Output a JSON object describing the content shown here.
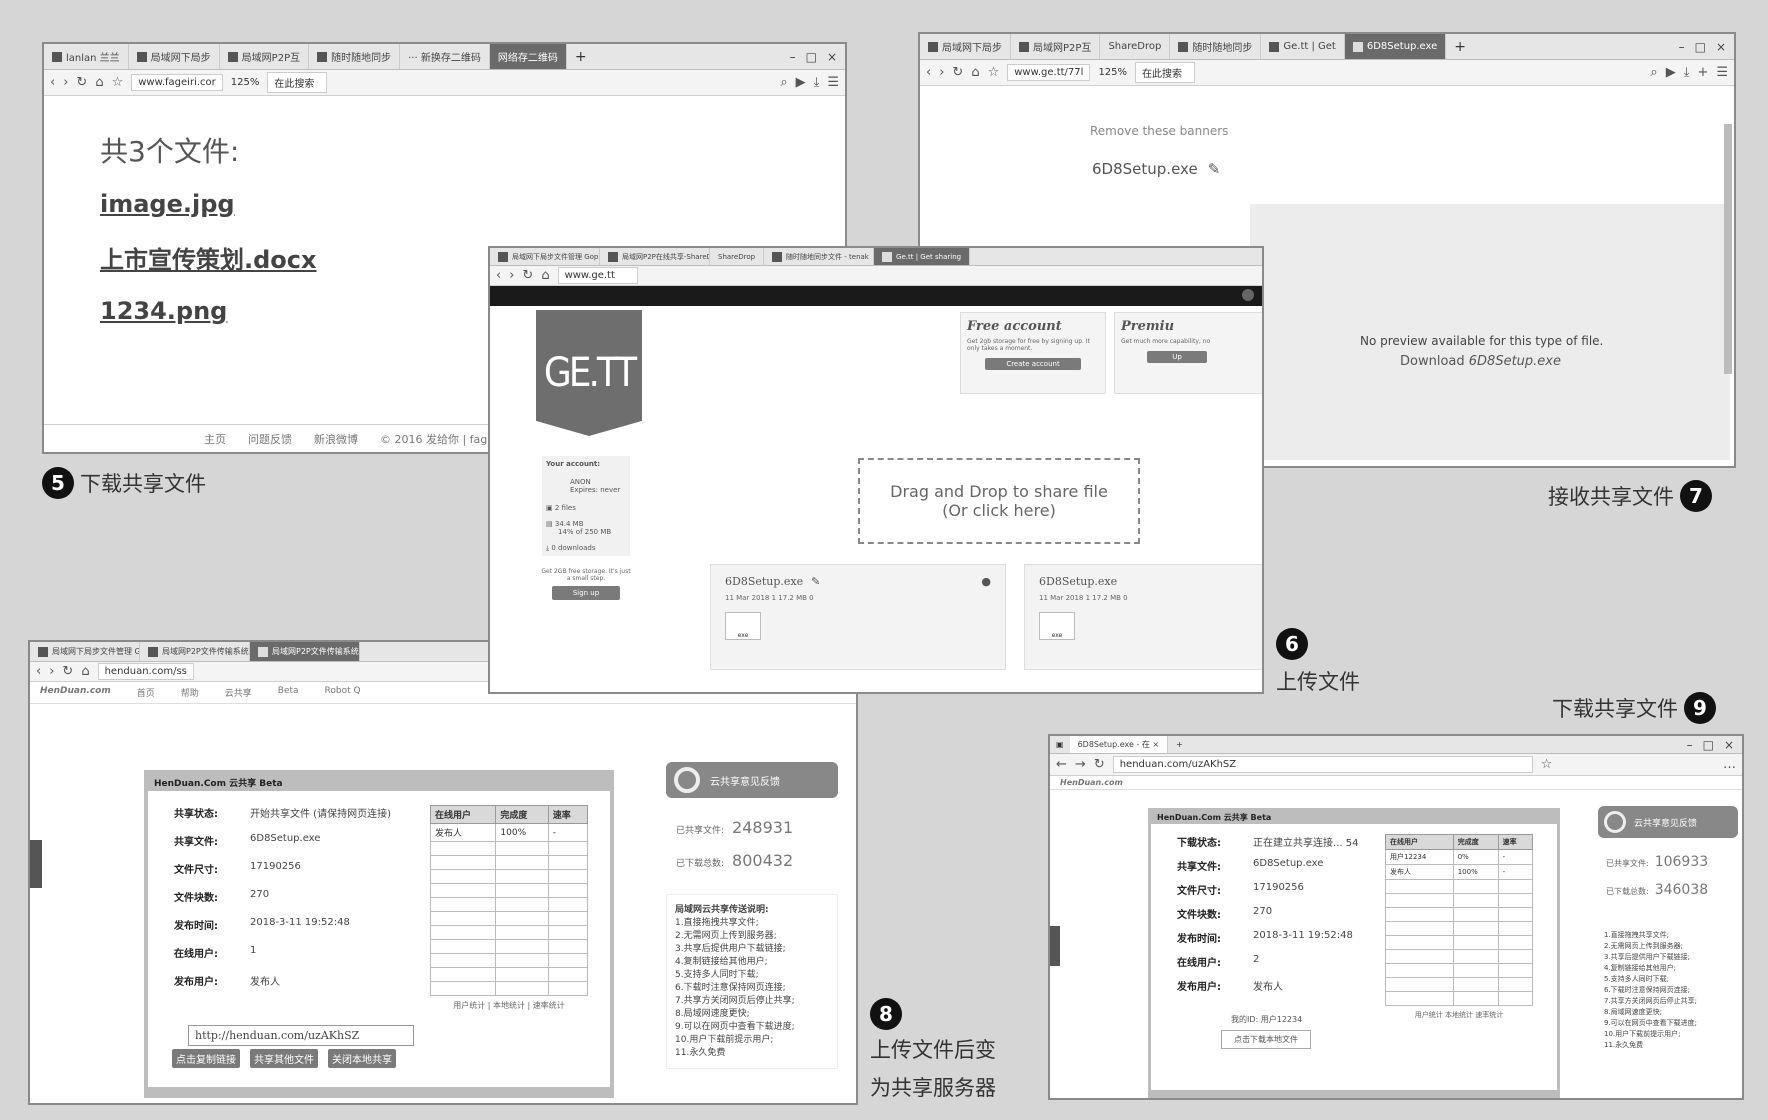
{
  "p5": {
    "tabs": [
      "lanlan 兰兰",
      "局域网下局步",
      "局域网P2P互",
      "随时随地同步",
      "··· 新换存二维码",
      "网络存二维码"
    ],
    "url": "www.fageiri.cor",
    "zoom": "125%",
    "search": "在此搜索",
    "heading": "共3个文件:",
    "files": [
      "image.jpg",
      "上市宣传策划.docx",
      "1234.png"
    ],
    "footer": [
      "主页",
      "问题反馈",
      "新浪微博",
      "© 2016 发给你 | fag"
    ],
    "label": "下载共享文件",
    "num": "5"
  },
  "p7": {
    "tabs": [
      "局域网下局步",
      "局域网P2P互",
      "ShareDrop",
      "随时随地同步",
      "Ge.tt | Get",
      "6D8Setup.exe"
    ],
    "url": "www.ge.tt/77l",
    "zoom": "125%",
    "search": "在此搜索",
    "banner": "Remove these banners",
    "filename": "6D8Setup.exe",
    "no_preview": "No preview available for this type of file.",
    "download_prefix": "Download",
    "download_file": "6D8Setup.exe",
    "label": "接收共享文件",
    "num": "7"
  },
  "p6": {
    "tabs": [
      "局域网下局步文件管理 Gopro.tv",
      "局域网P2P在线共享-ShareDrop",
      "ShareDrop",
      "随时随地同步文件 - tenak",
      "Ge.tt | Get sharing"
    ],
    "url": "www.ge.tt",
    "logo": "GE.TT",
    "free_title": "Free account",
    "free_desc": "Get 2gb storage for free by signing up. It only takes a moment.",
    "free_btn": "Create account",
    "premium_title": "Premiu",
    "premium_desc": "Get much more capability, no",
    "premium_btn": "Up",
    "account_title": "Your account:",
    "account_line1": "ANON",
    "account_line2": "Expires: never",
    "stats": [
      "2 files",
      "34.4 MB",
      "14% of 250 MB",
      "0 downloads"
    ],
    "promo": "Get 2GB free storage. It's just a small step.",
    "signup": "Sign up",
    "drop_line1": "Drag and Drop to share file",
    "drop_line2": "(Or click here)",
    "file_name": "6D8Setup.exe",
    "file_meta": "11 Mar 2018   1   17.2 MB   0",
    "file_ext": "exe",
    "label": "上传文件",
    "num": "6"
  },
  "p8": {
    "tabs": [
      "局域网下局步文件管理 Gopro.tv",
      "局域网P2P文件传输系统-众共享 | 免费",
      "局域网P2P文件传输系统-众共享 | 免费"
    ],
    "url": "henduan.com/ss",
    "site": "HenDuan.com",
    "nav": [
      "首页",
      "帮助",
      "云共享",
      "Beta",
      "Robot Q"
    ],
    "panel_title": "HenDuan.Com 云共享 Beta",
    "fields": [
      {
        "k": "共享状态:",
        "v": "开始共享文件 (请保持网页连接)"
      },
      {
        "k": "共享文件:",
        "v": "6D8Setup.exe"
      },
      {
        "k": "文件尺寸:",
        "v": "17190256"
      },
      {
        "k": "文件块数:",
        "v": "270"
      },
      {
        "k": "发布时间:",
        "v": "2018-3-11 19:52:48"
      },
      {
        "k": "在线用户:",
        "v": "1"
      },
      {
        "k": "发布用户:",
        "v": "发布人"
      }
    ],
    "share_url": "http://henduan.com/uzAKhSZ",
    "buttons": [
      "点击复制链接",
      "共享其他文件",
      "关闭本地共享"
    ],
    "table_head": [
      "在线用户",
      "完成度",
      "速率"
    ],
    "table_row": [
      "发布人",
      "100%",
      "-"
    ],
    "table_footer": "用户统计 | 本地统计 | 速率统计",
    "feedback": "云共享意见反馈",
    "stat1_label": "已共享文件:",
    "stat1_value": "248931",
    "stat2_label": "已下载总数:",
    "stat2_value": "800432",
    "steps_title": "局域网云共享传送说明:",
    "steps": [
      "1.直接拖拽共享文件;",
      "2.无需网页上传到服务器;",
      "3.共享后提供用户下载链接;",
      "4.复制链接给其他用户;",
      "5.支持多人同时下载;",
      "6.下载时注意保持网页连接;",
      "7.共享方关闭网页后停止共享;",
      "8.局域网速度更快;",
      "9.可以在网页中查看下载进度;",
      "10.用户下载前提示用户;",
      "11.永久免费"
    ],
    "label_line1": "上传文件后变",
    "label_line2": "为共享服务器",
    "num": "8"
  },
  "p9": {
    "tab": "6D8Setup.exe - 在 ×",
    "url": "henduan.com/uzAKhSZ",
    "site": "HenDuan.com",
    "panel_title": "HenDuan.Com 云共享 Beta",
    "fields": [
      {
        "k": "下载状态:",
        "v": "正在建立共享连接... 54"
      },
      {
        "k": "共享文件:",
        "v": "6D8Setup.exe"
      },
      {
        "k": "文件尺寸:",
        "v": "17190256"
      },
      {
        "k": "文件块数:",
        "v": "270"
      },
      {
        "k": "发布时间:",
        "v": "2018-3-11 19:52:48"
      },
      {
        "k": "在线用户:",
        "v": "2"
      },
      {
        "k": "发布用户:",
        "v": "发布人"
      }
    ],
    "user_line": "我的ID: 用户12234",
    "button": "点击下载本地文件",
    "table_head": [
      "在线用户",
      "完成度",
      "速率"
    ],
    "table_rows": [
      [
        "用户12234",
        "0%",
        "-"
      ],
      [
        "发布人",
        "100%",
        "-"
      ]
    ],
    "table_footer": "用户统计 本地统计 速率统计",
    "feedback": "云共享意见反馈",
    "stat1_label": "已共享文件:",
    "stat1_value": "106933",
    "stat2_label": "已下载总数:",
    "stat2_value": "346038",
    "label": "下载共享文件",
    "num": "9"
  }
}
